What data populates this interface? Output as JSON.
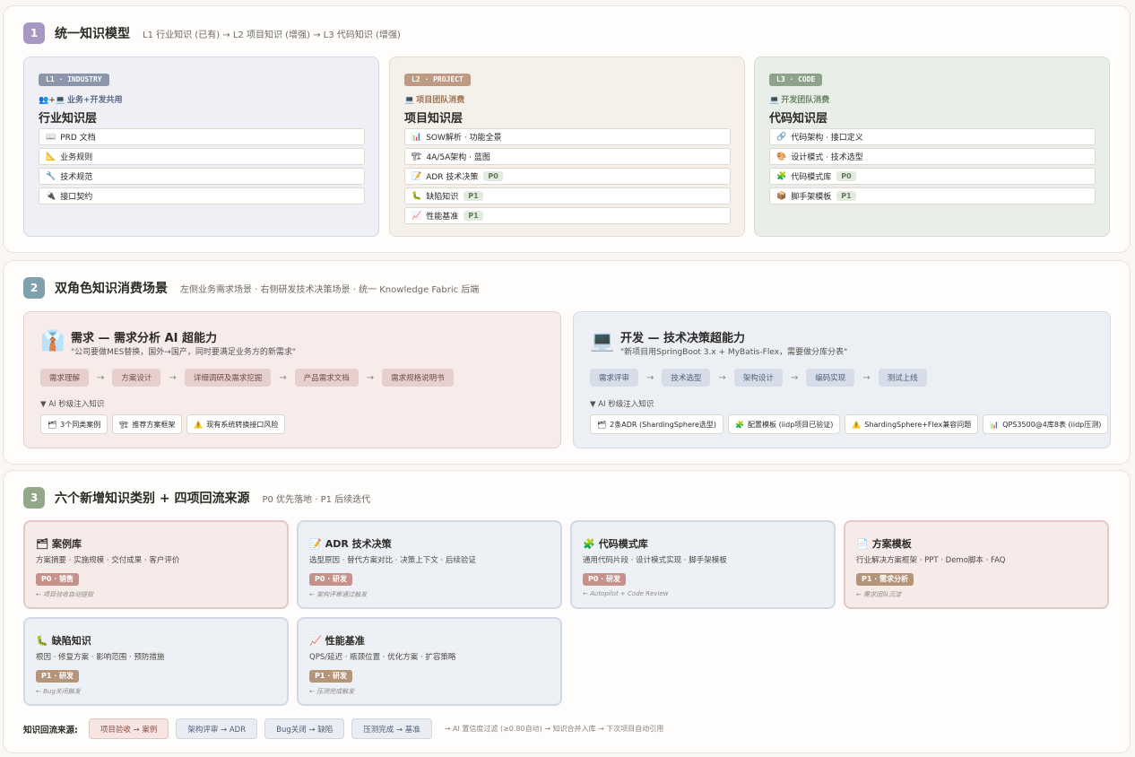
{
  "colors": {
    "s1_num": "#a797c4",
    "s2_num": "#7fa1ad",
    "s3_num": "#93a88a",
    "l1_tag": "#8b95ab",
    "l2_tag": "#bf9a82",
    "l3_tag": "#8da48a",
    "badge_red": "#c4928b",
    "badge_brown": "#b4957a"
  },
  "section1": {
    "num": "1",
    "title": "统一知识模型",
    "subtitle": "L1 行业知识 (已有) → L2 项目知识 (增强) → L3 代码知识 (增强)",
    "layers": [
      {
        "tag": "L1 · INDUSTRY",
        "audience_icon": "👥+💻",
        "audience": "业务+开发共用",
        "title": "行业知识层",
        "items": [
          {
            "icon": "📖",
            "label": "PRD 文档"
          },
          {
            "icon": "📐",
            "label": "业务规则"
          },
          {
            "icon": "🔧",
            "label": "技术规范"
          },
          {
            "icon": "🔌",
            "label": "接口契约"
          }
        ]
      },
      {
        "tag": "L2 · PROJECT",
        "audience_icon": "💻",
        "audience": "项目团队消费",
        "title": "项目知识层",
        "items": [
          {
            "icon": "📊",
            "label": "SOW解析 · 功能全景"
          },
          {
            "icon": "🏗",
            "label": "4A/5A架构 · 蓝图"
          },
          {
            "icon": "📝",
            "label": "ADR 技术决策",
            "badge": "P0"
          },
          {
            "icon": "🐛",
            "label": "缺陷知识",
            "badge": "P1"
          },
          {
            "icon": "📈",
            "label": "性能基准",
            "badge": "P1"
          }
        ]
      },
      {
        "tag": "L3 · CODE",
        "audience_icon": "💻",
        "audience": "开发团队消费",
        "title": "代码知识层",
        "items": [
          {
            "icon": "🔗",
            "label": "代码架构 · 接口定义"
          },
          {
            "icon": "🎨",
            "label": "设计模式 · 技术选型"
          },
          {
            "icon": "🧩",
            "label": "代码模式库",
            "badge": "P0"
          },
          {
            "icon": "📦",
            "label": "脚手架模板",
            "badge": "P1"
          }
        ]
      }
    ]
  },
  "section2": {
    "num": "2",
    "title": "双角色知识消费场景",
    "subtitle": "左侧业务需求场景 · 右侧研发技术决策场景 · 统一 Knowledge Fabric 后端",
    "scenarios": [
      {
        "icon": "👔",
        "title": "需求 — 需求分析 AI 超能力",
        "quote": "\"公司要做MES替换，国外→国产，同时要满足业务方的新需求\"",
        "steps": [
          "需求理解",
          "方案设计",
          "详细调研及需求挖掘",
          "产品需求文档",
          "需求规格说明书"
        ],
        "inject_label": "▼ AI 秒级注入知识",
        "chips": [
          {
            "icon": "🗂",
            "label": "3个同类案例"
          },
          {
            "icon": "🏗",
            "label": "推荐方案框架"
          },
          {
            "icon": "⚠️",
            "label": "现有系统转换接口风险"
          }
        ]
      },
      {
        "icon": "💻",
        "title": "开发 — 技术决策超能力",
        "quote": "\"新项目用SpringBoot 3.x + MyBatis-Flex，需要做分库分表\"",
        "steps": [
          "需求评审",
          "技术选型",
          "架构设计",
          "编码实现",
          "测试上线"
        ],
        "inject_label": "▼ AI 秒级注入知识",
        "chips": [
          {
            "icon": "🗂",
            "label": "2条ADR (ShardingSphere选型)"
          },
          {
            "icon": "🧩",
            "label": "配置模板 (iidp项目已验证)"
          },
          {
            "icon": "⚠️",
            "label": "ShardingSphere+Flex兼容问题"
          },
          {
            "icon": "📊",
            "label": "QPS3500@4库8表 (iidp压测)"
          }
        ]
      }
    ]
  },
  "section3": {
    "num": "3",
    "title": "六个新增知识类别 + 四项回流来源",
    "subtitle": "P0 优先落地 · P1 后续迭代",
    "categories": [
      {
        "icon": "🗂",
        "title": "案例库",
        "desc": "方案摘要 · 实施规模 · 交付成果 · 客户评价",
        "badge": "P0 · 销售",
        "source": "← 项目验收自动提取",
        "tone": "red",
        "badge_tone": "red"
      },
      {
        "icon": "📝",
        "title": "ADR 技术决策",
        "desc": "选型原因 · 替代方案对比 · 决策上下文 · 后续验证",
        "badge": "P0 · 研发",
        "source": "← 架构评审通过触发",
        "tone": "blue",
        "badge_tone": "red"
      },
      {
        "icon": "🧩",
        "title": "代码模式库",
        "desc": "通用代码片段 · 设计模式实现 · 脚手架模板",
        "badge": "P0 · 研发",
        "source": "← Autopilot + Code Review",
        "tone": "blue",
        "badge_tone": "red"
      },
      {
        "icon": "📄",
        "title": "方案模板",
        "desc": "行业解决方案框架 · PPT · Demo脚本 · FAQ",
        "badge": "P1 · 需求分析",
        "source": "← 需求团队沉淀",
        "tone": "red",
        "badge_tone": "brown"
      },
      {
        "icon": "🐛",
        "title": "缺陷知识",
        "desc": "根因 · 修复方案 · 影响范围 · 预防措施",
        "badge": "P1 · 研发",
        "source": "← Bug关闭触发",
        "tone": "blue",
        "badge_tone": "brown"
      },
      {
        "icon": "📈",
        "title": "性能基准",
        "desc": "QPS/延迟 · 瓶颈位置 · 优化方案 · 扩容策略",
        "badge": "P1 · 研发",
        "source": "← 压测完成触发",
        "tone": "blue",
        "badge_tone": "brown"
      }
    ],
    "return_label": "知识回流来源:",
    "returns": [
      {
        "label": "项目验收 → 案例",
        "tone": "red"
      },
      {
        "label": "架构评审 → ADR",
        "tone": "blue"
      },
      {
        "label": "Bug关闭 → 缺陷",
        "tone": "blue"
      },
      {
        "label": "压测完成 → 基准",
        "tone": "blue"
      }
    ],
    "return_tail": "→ AI 置信度过滤 (≥0.80自动) → 知识合并入库 → 下次项目自动引用"
  }
}
